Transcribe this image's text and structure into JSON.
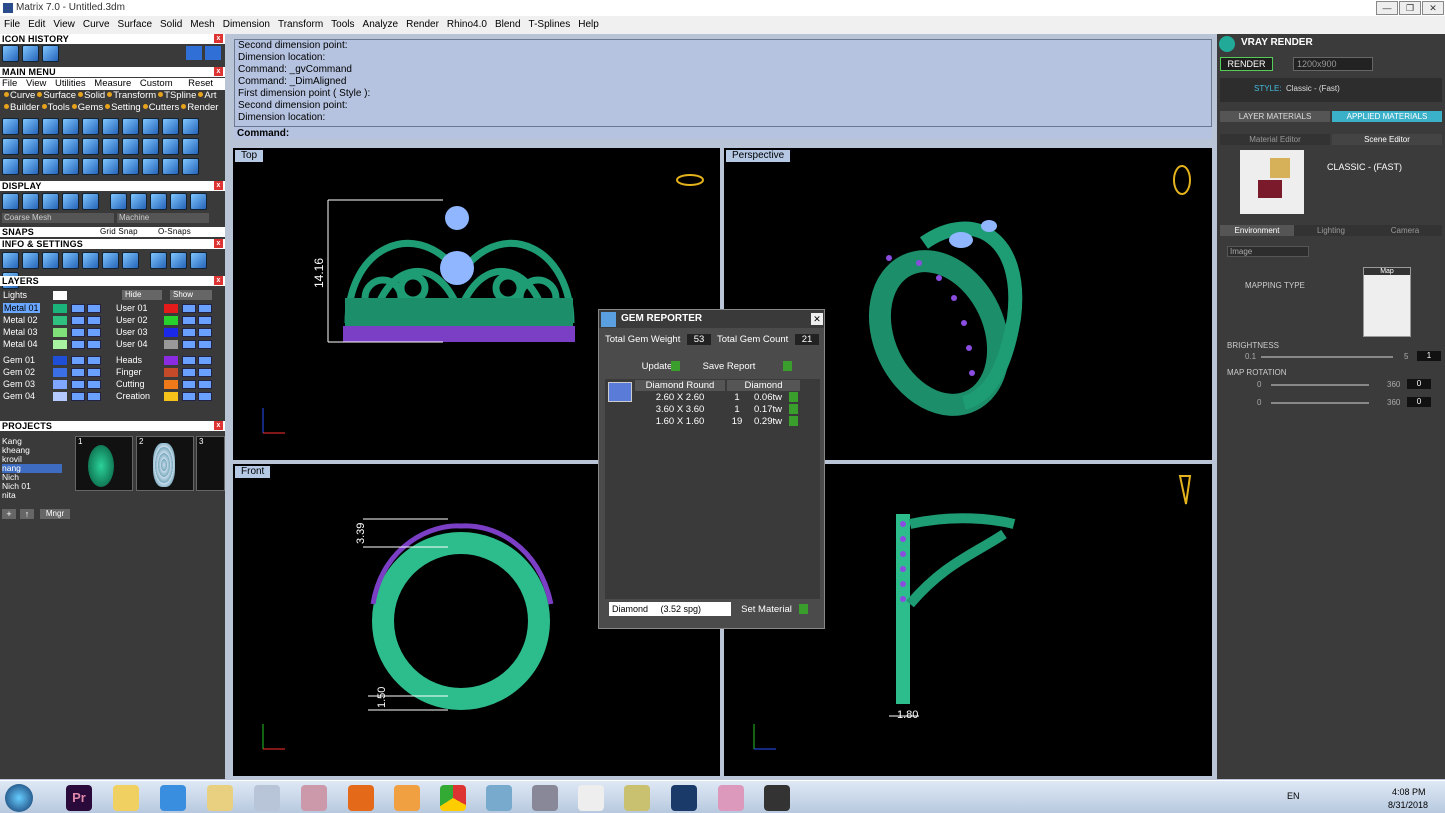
{
  "window": {
    "title": "Matrix 7.0 - Untitled.3dm",
    "min": "—",
    "max": "❐",
    "close": "✕"
  },
  "menu": [
    "File",
    "Edit",
    "View",
    "Curve",
    "Surface",
    "Solid",
    "Mesh",
    "Dimension",
    "Transform",
    "Tools",
    "Analyze",
    "Render",
    "Rhino4.0",
    "Blend",
    "T-Splines",
    "Help"
  ],
  "left": {
    "icon_history": "ICON HISTORY",
    "main_menu": "MAIN MENU",
    "mm_row1": [
      "File",
      "View",
      "Utilities",
      "Measure",
      "Custom",
      "Reset"
    ],
    "mm_row2": [
      "Curve",
      "Surface",
      "Solid",
      "Transform",
      "TSpline",
      "Art"
    ],
    "mm_row3": [
      "Builder",
      "Tools",
      "Gems",
      "Setting",
      "Cutters",
      "Render"
    ],
    "display": "DISPLAY",
    "mesh_mode": "Coarse Mesh",
    "machine": "Machine",
    "snaps": "SNAPS",
    "grid_snap": "Grid Snap",
    "o_snaps": "O-Snaps",
    "info": "INFO & SETTINGS",
    "layers": "LAYERS",
    "lights": "Lights",
    "hide": "Hide",
    "show": "Show",
    "layers_left": [
      "Metal 01",
      "Metal 02",
      "Metal 03",
      "Metal 04",
      "Gem 01",
      "Gem 02",
      "Gem 03",
      "Gem 04"
    ],
    "layers_right": [
      "User 01",
      "User 02",
      "User 03",
      "User 04",
      "Heads",
      "Finger",
      "Cutting",
      "Creation"
    ],
    "projects": "PROJECTS",
    "project_list": [
      "Kang",
      "kheang",
      "krovil",
      "nang",
      "Nich",
      "Nich 01",
      "nita"
    ],
    "thumb_nums": [
      "1",
      "2",
      "3"
    ],
    "mngr": "Mngr"
  },
  "command": {
    "lines": [
      "Second dimension point:",
      "Dimension location:",
      "Command: _gvCommand",
      "Command: _DimAligned",
      "First dimension point ( Style ):",
      "Second dimension point:",
      "Dimension location:"
    ],
    "prompt": "Command:"
  },
  "viewports": {
    "top": "Top",
    "perspective": "Perspective",
    "front": "Front",
    "dim_top": "14.16",
    "dim_front1": "3.39",
    "dim_front2": "1.50",
    "dim_side": "1.80"
  },
  "gem_reporter": {
    "title": "GEM REPORTER",
    "weight_label": "Total Gem Weight",
    "weight": "53",
    "count_label": "Total Gem Count",
    "count": "21",
    "update": "Update",
    "save": "Save Report",
    "col1": "Diamond Round",
    "col2": "Diamond",
    "rows": [
      {
        "size": "2.60 X 2.60",
        "qty": "1",
        "tw": "0.06tw"
      },
      {
        "size": "3.60 X 3.60",
        "qty": "1",
        "tw": "0.17tw"
      },
      {
        "size": "1.60 X 1.60",
        "qty": "19",
        "tw": "0.29tw"
      }
    ],
    "material": "Diamond     (3.52 spg)",
    "set_material": "Set Material"
  },
  "vray": {
    "title": "VRAY RENDER",
    "render": "RENDER",
    "resolution": "1200x900",
    "style_label": "STYLE:",
    "style": "Classic - (Fast)",
    "layer_materials": "LAYER MATERIALS",
    "applied_materials": "APPLIED MATERIALS",
    "material_editor": "Material Editor",
    "scene_editor": "Scene Editor",
    "preset": "CLASSIC - (FAST)",
    "tabs": [
      "Environment",
      "Lighting",
      "Camera"
    ],
    "env_type": "Image",
    "map": "Map",
    "mapping_type": "MAPPING TYPE",
    "brightness": "BRIGHTNESS",
    "b_min": "0.1",
    "b_max": "5",
    "b_val": "1",
    "map_rotation": "MAP ROTATION",
    "r1_min": "0",
    "r1_max": "360",
    "r1_val": "0",
    "r2_min": "0",
    "r2_max": "360",
    "r2_val": "0"
  },
  "taskbar": {
    "lang": "EN",
    "time": "4:08 PM",
    "date": "8/31/2018",
    "pr": "Pr"
  }
}
